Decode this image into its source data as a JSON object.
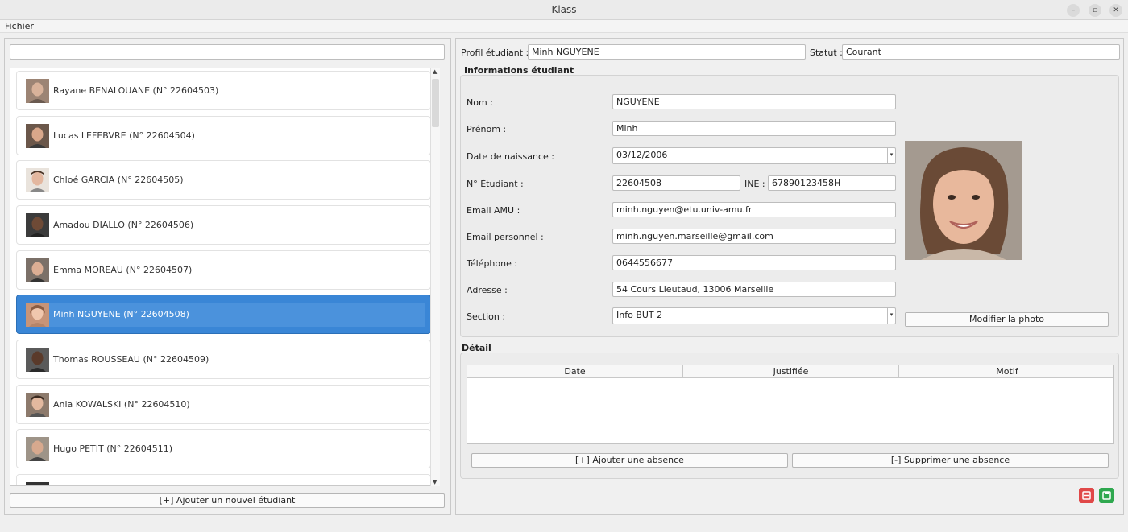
{
  "window": {
    "title": "Klass"
  },
  "menu": {
    "file": "Fichier"
  },
  "search": {
    "value": ""
  },
  "students": [
    {
      "label": "Rayane BENALOUANE (N° 22604503)",
      "selected": false
    },
    {
      "label": "Lucas LEFEBVRE (N° 22604504)",
      "selected": false
    },
    {
      "label": "Chloé GARCIA (N° 22604505)",
      "selected": false
    },
    {
      "label": "Amadou DIALLO (N° 22604506)",
      "selected": false
    },
    {
      "label": "Emma MOREAU (N° 22604507)",
      "selected": false
    },
    {
      "label": "Minh NGUYENE (N° 22604508)",
      "selected": true
    },
    {
      "label": "Thomas ROUSSEAU (N° 22604509)",
      "selected": false
    },
    {
      "label": "Ania KOWALSKI (N° 22604510)",
      "selected": false
    },
    {
      "label": "Hugo PETIT (N° 22604511)",
      "selected": false
    }
  ],
  "add_student_label": "[+] Ajouter un nouvel étudiant",
  "profile": {
    "profile_label": "Profil étudiant :",
    "profile_value": "Minh NGUYENE",
    "status_label": "Statut :",
    "status_value": "Courant"
  },
  "info": {
    "title": "Informations étudiant",
    "nom_label": "Nom :",
    "nom_value": "NGUYENE",
    "prenom_label": "Prénom :",
    "prenom_value": "Minh",
    "dob_label": "Date de naissance :",
    "dob_value": "03/12/2006",
    "num_label": "N° Étudiant :",
    "num_value": "22604508",
    "ine_label": "INE :",
    "ine_value": "67890123458H",
    "email_amu_label": "Email AMU :",
    "email_amu_value": "minh.nguyen@etu.univ-amu.fr",
    "email_perso_label": "Email personnel :",
    "email_perso_value": "minh.nguyen.marseille@gmail.com",
    "tel_label": "Téléphone :",
    "tel_value": "0644556677",
    "address_label": "Adresse :",
    "address_value": "54 Cours Lieutaud, 13006 Marseille",
    "section_label": "Section :",
    "section_value": "Info BUT 2",
    "photo_button": "Modifier la photo"
  },
  "detail": {
    "title": "Détail",
    "columns": [
      "Date",
      "Justifiée",
      "Motif"
    ],
    "add_absence": "[+] Ajouter une absence",
    "remove_absence": "[-] Supprimer une absence"
  },
  "colors": {
    "selection": "#3a86d6",
    "cancel": "#e04848",
    "save": "#2fa84f"
  }
}
